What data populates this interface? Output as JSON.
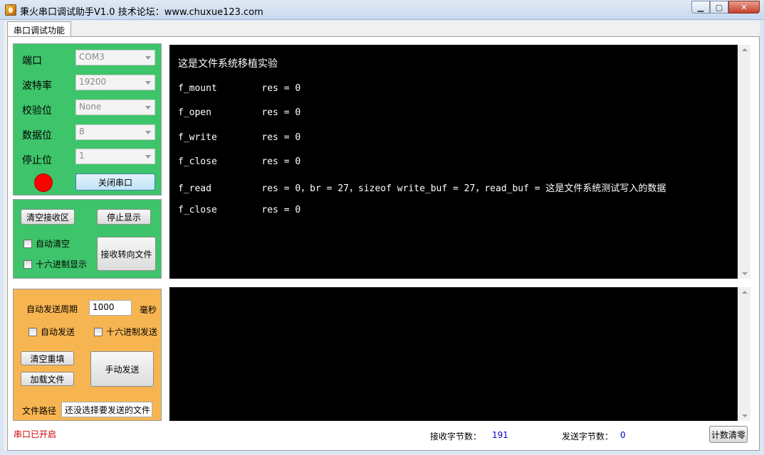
{
  "window": {
    "title": "秉火串口调试助手V1.0      技术论坛：www.chuxue123.com",
    "minimize_glyph": "▁",
    "maximize_glyph": "▢",
    "close_glyph": "✕"
  },
  "tabs": [
    {
      "label": "串口调试功能",
      "active": true
    }
  ],
  "port_settings": {
    "port_label": "端口",
    "port_value": "COM3",
    "baud_label": "波特率",
    "baud_value": "19200",
    "parity_label": "校验位",
    "parity_value": "None",
    "databits_label": "数据位",
    "databits_value": "8",
    "stopbits_label": "停止位",
    "stopbits_value": "1",
    "close_port_label": "关闭串口",
    "led_color": "#ff0000"
  },
  "receive_controls": {
    "clear_label": "清空接收区",
    "stop_display_label": "停止显示",
    "auto_clear_label": "自动清空",
    "hex_display_label": "十六进制显示",
    "to_file_label": "接收转向文件"
  },
  "send_controls": {
    "period_label": "自动发送周期",
    "period_value": "1000",
    "period_unit": "毫秒",
    "auto_send_label": "自动发送",
    "hex_send_label": "十六进制发送",
    "clear_refill_label": "清空重填",
    "load_file_label": "加载文件",
    "manual_send_label": "手动发送",
    "file_path_label": "文件路径",
    "file_path_value": "还没选择要发送的文件"
  },
  "receive_text": [
    "这是文件系统移植实验",
    "f_mount        res = 0",
    "f_open         res = 0",
    "f_write        res = 0",
    "f_close        res = 0",
    "f_read         res = 0，br = 27，sizeof write_buf = 27，read_buf = 这是文件系统测试写入的数据",
    "f_close        res = 0"
  ],
  "status": {
    "port_status": "串口已开启",
    "rx_label": "接收字节数：",
    "rx_value": "191",
    "tx_label": "发送字节数：",
    "tx_value": "0",
    "reset_label": "计数清零"
  },
  "colors": {
    "settings_panel": "#3ec46a",
    "send_panel": "#f7b551",
    "terminal_bg": "#000000",
    "port_status_text": "#d00000"
  }
}
